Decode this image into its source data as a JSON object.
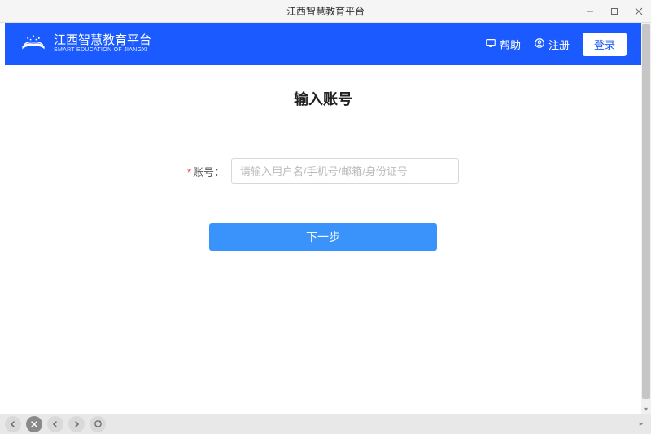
{
  "window": {
    "title": "江西智慧教育平台"
  },
  "header": {
    "logo_main": "江西智慧教育平台",
    "logo_sub": "SMART EDUCATION OF JIANGXI",
    "help_label": "帮助",
    "register_label": "注册",
    "login_label": "登录"
  },
  "page": {
    "heading": "输入账号",
    "account_label": "账号：",
    "account_placeholder": "请输入用户名/手机号/邮箱/身份证号",
    "next_button": "下一步"
  }
}
